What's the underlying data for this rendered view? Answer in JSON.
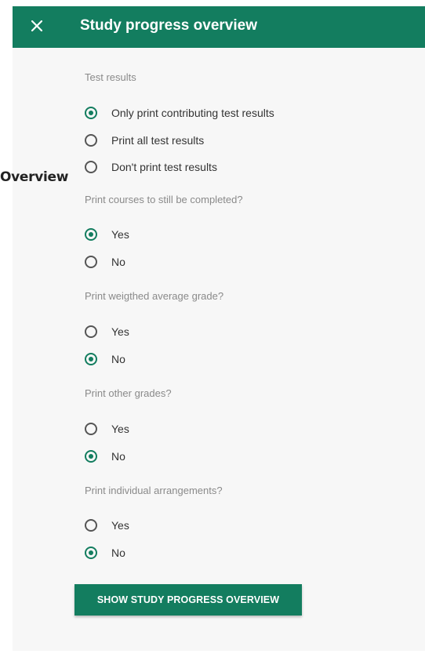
{
  "header": {
    "title": "Study progress overview",
    "close_icon": "close-icon",
    "bg_color": "#137d5f"
  },
  "stray_label": "Overview",
  "sections": [
    {
      "label": "Test results",
      "options": [
        {
          "label": "Only print contributing test results",
          "checked": true
        },
        {
          "label": "Print all test results",
          "checked": false
        },
        {
          "label": "Don't print test results",
          "checked": false
        }
      ]
    },
    {
      "label": "Print courses to still be completed?",
      "options": [
        {
          "label": "Yes",
          "checked": true
        },
        {
          "label": "No",
          "checked": false
        }
      ]
    },
    {
      "label": "Print weigthed average grade?",
      "options": [
        {
          "label": "Yes",
          "checked": false
        },
        {
          "label": "No",
          "checked": true
        }
      ]
    },
    {
      "label": "Print other grades?",
      "options": [
        {
          "label": "Yes",
          "checked": false
        },
        {
          "label": "No",
          "checked": true
        }
      ]
    },
    {
      "label": "Print individual arrangements?",
      "options": [
        {
          "label": "Yes",
          "checked": false
        },
        {
          "label": "No",
          "checked": true
        }
      ]
    }
  ],
  "show_button": {
    "label": "SHOW STUDY PROGRESS OVERVIEW"
  },
  "colors": {
    "accent": "#137d5f",
    "panel_bg": "#f7f7f7",
    "muted_text": "#8a8a8a"
  }
}
